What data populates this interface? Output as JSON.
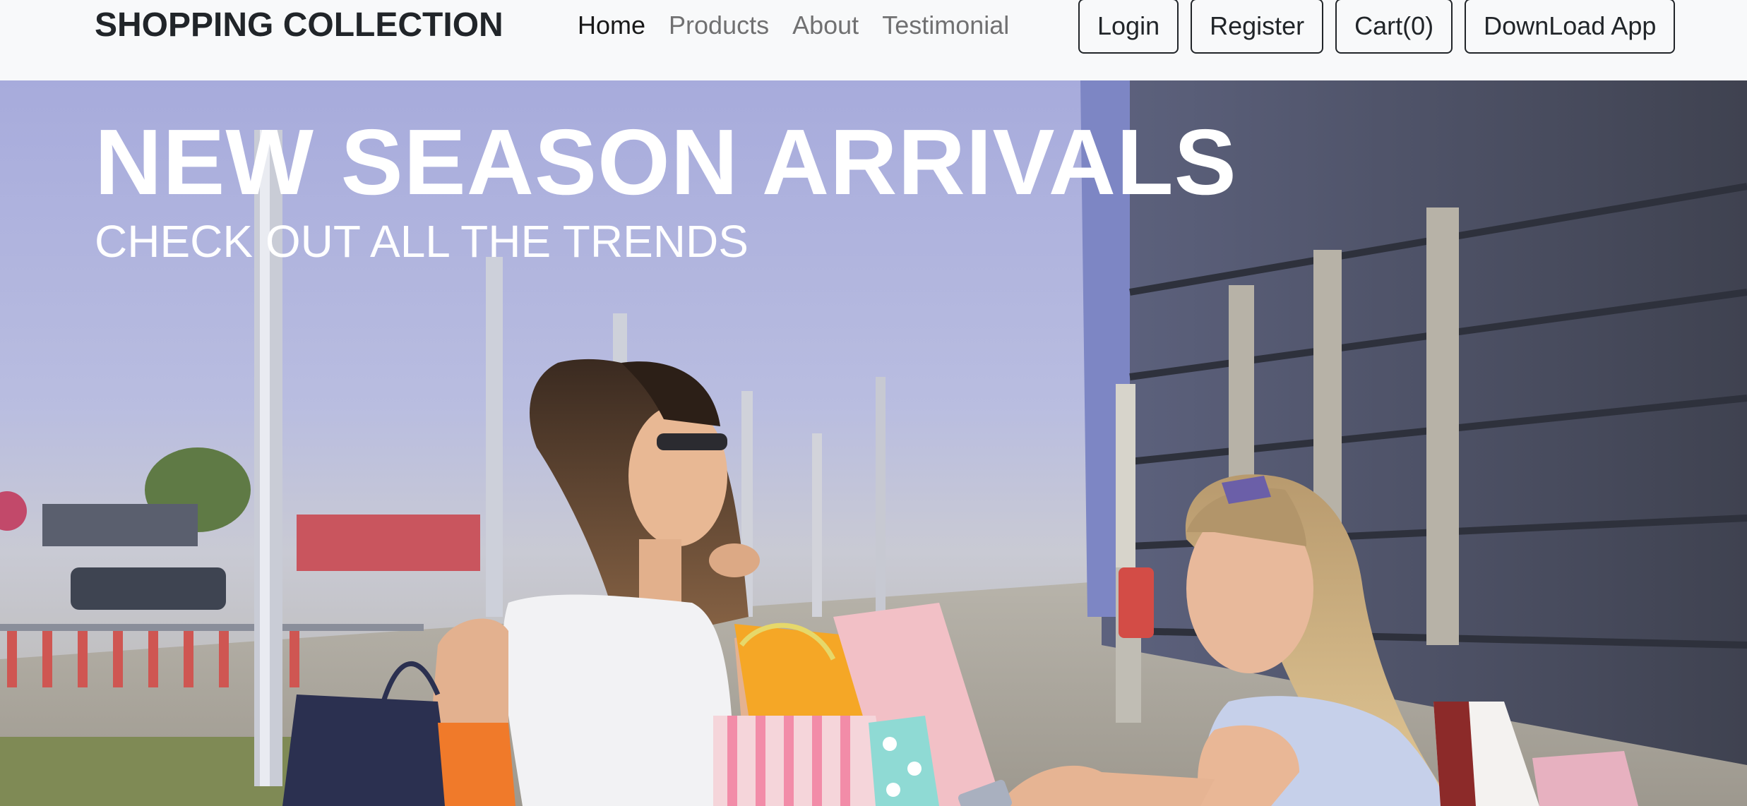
{
  "navbar": {
    "brand": "SHOPPING COLLECTION",
    "links": [
      {
        "label": "Home",
        "active": true
      },
      {
        "label": "Products",
        "active": false
      },
      {
        "label": "About",
        "active": false
      },
      {
        "label": "Testimonial",
        "active": false
      }
    ],
    "buttons": {
      "login": "Login",
      "register": "Register",
      "cart": "Cart(0)",
      "download": "DownLoad App"
    }
  },
  "hero": {
    "title": "NEW SEASON ARRIVALS",
    "subtitle": "CHECK OUT ALL THE TRENDS"
  },
  "colors": {
    "navbar_bg": "#f8f9fa",
    "text_dark": "#212529",
    "hero_text": "#ffffff"
  }
}
